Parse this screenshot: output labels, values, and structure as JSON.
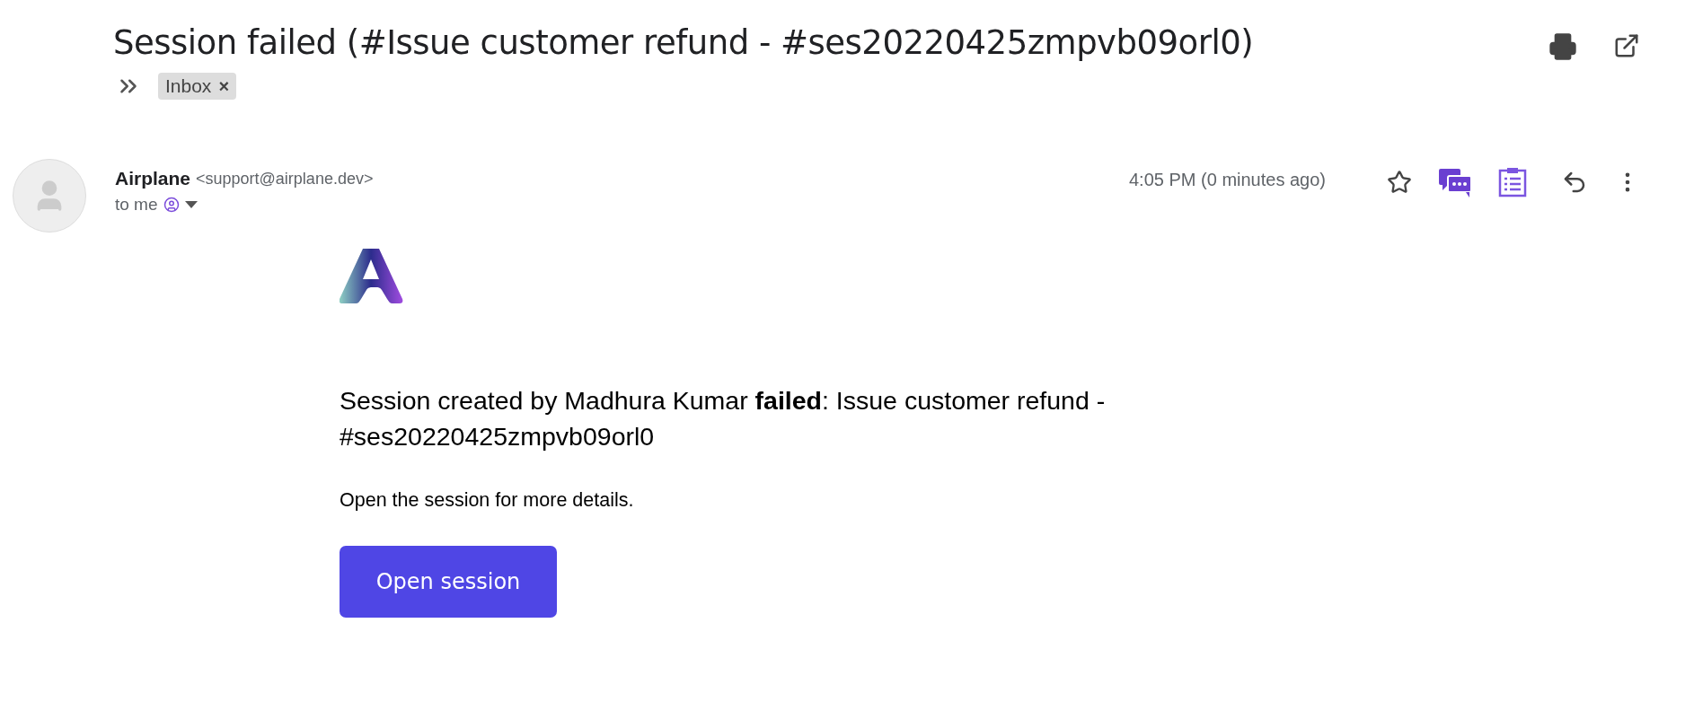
{
  "subject": "Session failed (#Issue customer refund - #ses20220425zmpvb09orl0)",
  "labels": [
    {
      "label": "Inbox",
      "remove": "×"
    }
  ],
  "message": {
    "sender_name": "Airplane",
    "sender_email": "<support@airplane.dev>",
    "recipient": "to me",
    "time": "4:05 PM (0 minutes ago)",
    "starred": false
  },
  "body": {
    "headline": "Session created by Madhura Kumar **failed**: Issue customer refund - #ses20220425zmpvb09orl0",
    "text": "Open the session for more details.",
    "button": "Open session"
  }
}
